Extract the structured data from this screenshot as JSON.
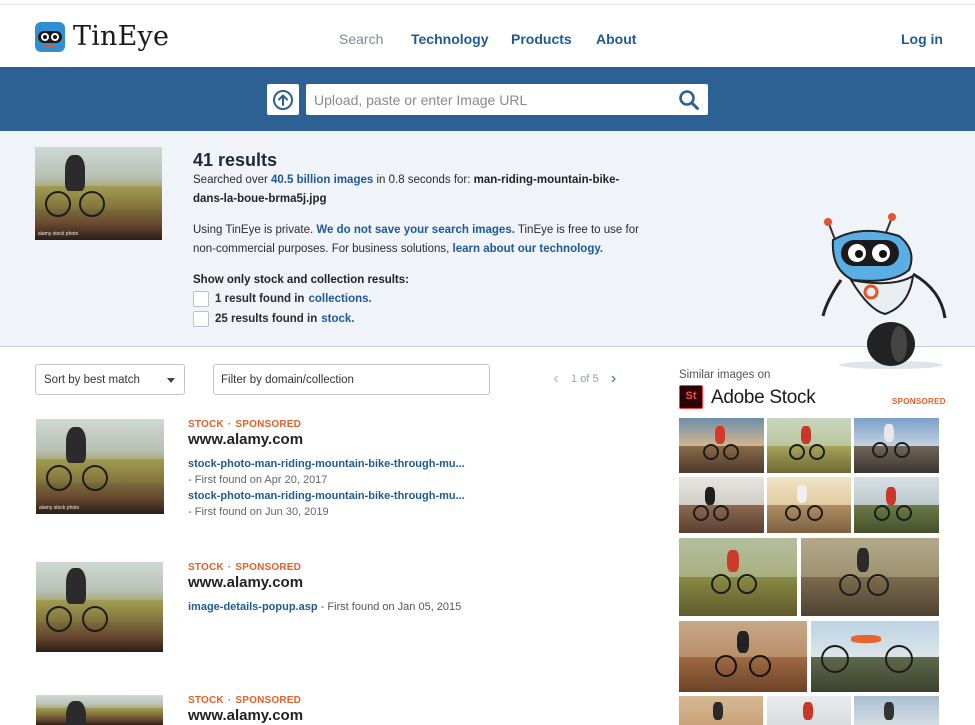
{
  "header": {
    "brand": "TinEye",
    "nav": [
      {
        "label": "Search",
        "muted": true
      },
      {
        "label": "Technology",
        "muted": false
      },
      {
        "label": "Products",
        "muted": false
      },
      {
        "label": "About",
        "muted": false
      }
    ],
    "login": "Log in"
  },
  "search": {
    "placeholder": "Upload, paste or enter Image URL"
  },
  "summary": {
    "title": "41 results",
    "searched_prefix": "Searched over ",
    "searched_count": "40.5 billion images",
    "searched_mid": " in 0.8 seconds for: ",
    "filename": "man-riding-mountain-bike-dans-la-boue-brma5j.jpg",
    "privacy_prefix": "Using TinEye is private. ",
    "privacy_link": "We do not save your search images.",
    "privacy_mid": " TinEye is free to use for non-commercial purposes. For business solutions, ",
    "privacy_link2": "learn about our technology.",
    "filter_heading": "Show only stock and collection results:",
    "filters": [
      {
        "count": "1 result found in",
        "link": "collections."
      },
      {
        "count": "25 results found in",
        "link": "stock."
      }
    ],
    "thumb_watermark": "alamy stock photo"
  },
  "controls": {
    "sort": "Sort by best match",
    "filter_placeholder": "Filter by domain/collection",
    "page": "1",
    "of": "of",
    "total_pages": "5"
  },
  "results": [
    {
      "tag1": "STOCK",
      "tag2": "SPONSORED",
      "domain": "www.alamy.com",
      "matches": [
        {
          "link": "stock-photo-man-riding-mountain-bike-through-mu...",
          "found": "- First found on Apr 20, 2017"
        },
        {
          "link": "stock-photo-man-riding-mountain-bike-through-mu...",
          "found": "- First found on Jun 30, 2019"
        }
      ]
    },
    {
      "tag1": "STOCK",
      "tag2": "SPONSORED",
      "domain": "www.alamy.com",
      "matches": [
        {
          "link": "image-details-popup.asp",
          "found": " - First found on Jan 05, 2015"
        }
      ]
    },
    {
      "tag1": "STOCK",
      "tag2": "SPONSORED",
      "domain": "www.alamy.com",
      "matches": []
    }
  ],
  "sidebar": {
    "label": "Similar images on",
    "brand_mark": "St",
    "brand": "Adobe Stock",
    "sponsored": "SPONSORED"
  },
  "colors": {
    "brand_blue": "#2d6194",
    "link": "#1d5a96",
    "accent_orange": "#e2622a"
  }
}
